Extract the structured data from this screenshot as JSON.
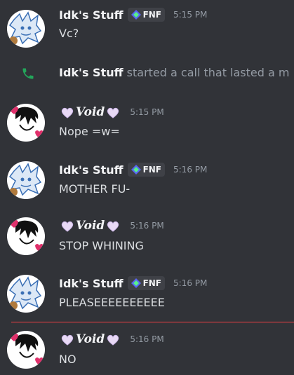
{
  "messages": [
    {
      "author": "Idk's Stuff",
      "tag": "FNF",
      "time": "5:15 PM",
      "text": "Vc?"
    },
    {
      "author": "🤍 Void 🤍",
      "time": "5:15 PM",
      "text": "Nope =w="
    },
    {
      "author": "Idk's Stuff",
      "tag": "FNF",
      "time": "5:16 PM",
      "text": "MOTHER FU-"
    },
    {
      "author": "🤍 Void 🤍",
      "time": "5:16 PM",
      "text": "STOP WHINING"
    },
    {
      "author": "Idk's Stuff",
      "tag": "FNF",
      "time": "5:16 PM",
      "text": "PLEASEEEEEEEEEE"
    },
    {
      "author": "🤍 Void 🤍",
      "time": "5:16 PM",
      "text": "NO"
    }
  ],
  "system": {
    "author": "Idk's Stuff",
    "text": " started a call that lasted a m"
  },
  "void_name": "Void",
  "colors": {
    "background": "#313338",
    "new_divider": "#f23f43",
    "phone_green": "#23a55a",
    "tag_diamond": "#5865f2"
  }
}
